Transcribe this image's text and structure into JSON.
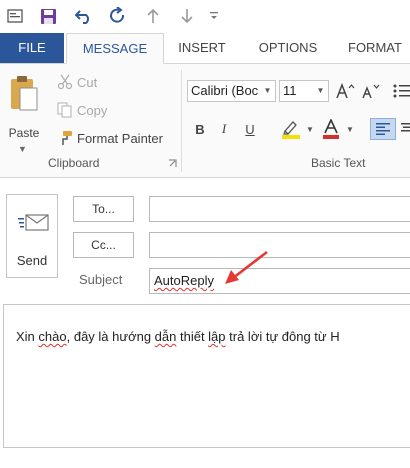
{
  "ribbon_tabs": {
    "file": "FILE",
    "message": "MESSAGE",
    "insert": "INSERT",
    "options": "OPTIONS",
    "format": "FORMAT"
  },
  "clipboard": {
    "paste_label": "Paste",
    "cut_label": "Cut",
    "copy_label": "Copy",
    "format_painter_label": "Format Painter",
    "group_label": "Clipboard"
  },
  "basic_text": {
    "font_name": "Calibri (Boc",
    "font_size": "11",
    "bold": "B",
    "italic": "I",
    "underline": "U",
    "group_label": "Basic Text",
    "highlight_color": "#f5e10a",
    "font_color": "#d32f2f"
  },
  "compose": {
    "send_label": "Send",
    "to_label": "To...",
    "cc_label": "Cc...",
    "subject_label": "Subject",
    "subject_value": "AutoReply",
    "body_parts": [
      "Xin ",
      "chào",
      ", đây là hướng ",
      "dẫn",
      " thiết ",
      "lập",
      " trả lời tự đông từ H"
    ]
  },
  "colors": {
    "accent": "#2b579a",
    "annotation_arrow": "#e53935"
  }
}
